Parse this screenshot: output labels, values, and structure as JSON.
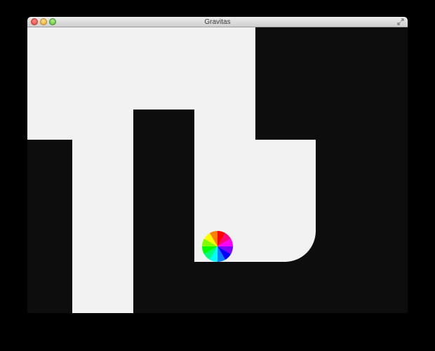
{
  "window": {
    "title": "Gravitas"
  },
  "icons": {
    "close": "close-icon",
    "minimize": "minimize-icon",
    "zoom": "zoom-icon",
    "fullscreen": "fullscreen-icon"
  },
  "colors": {
    "wall": "#0d0d0d",
    "floor": "#f2f2f2",
    "ball": [
      "#ff0000",
      "#ff0080",
      "#ff00ff",
      "#8000ff",
      "#0000ff",
      "#0080ff",
      "#00ffff",
      "#00ff80",
      "#00ff00",
      "#80ff00",
      "#ffff00",
      "#ff8000"
    ]
  }
}
